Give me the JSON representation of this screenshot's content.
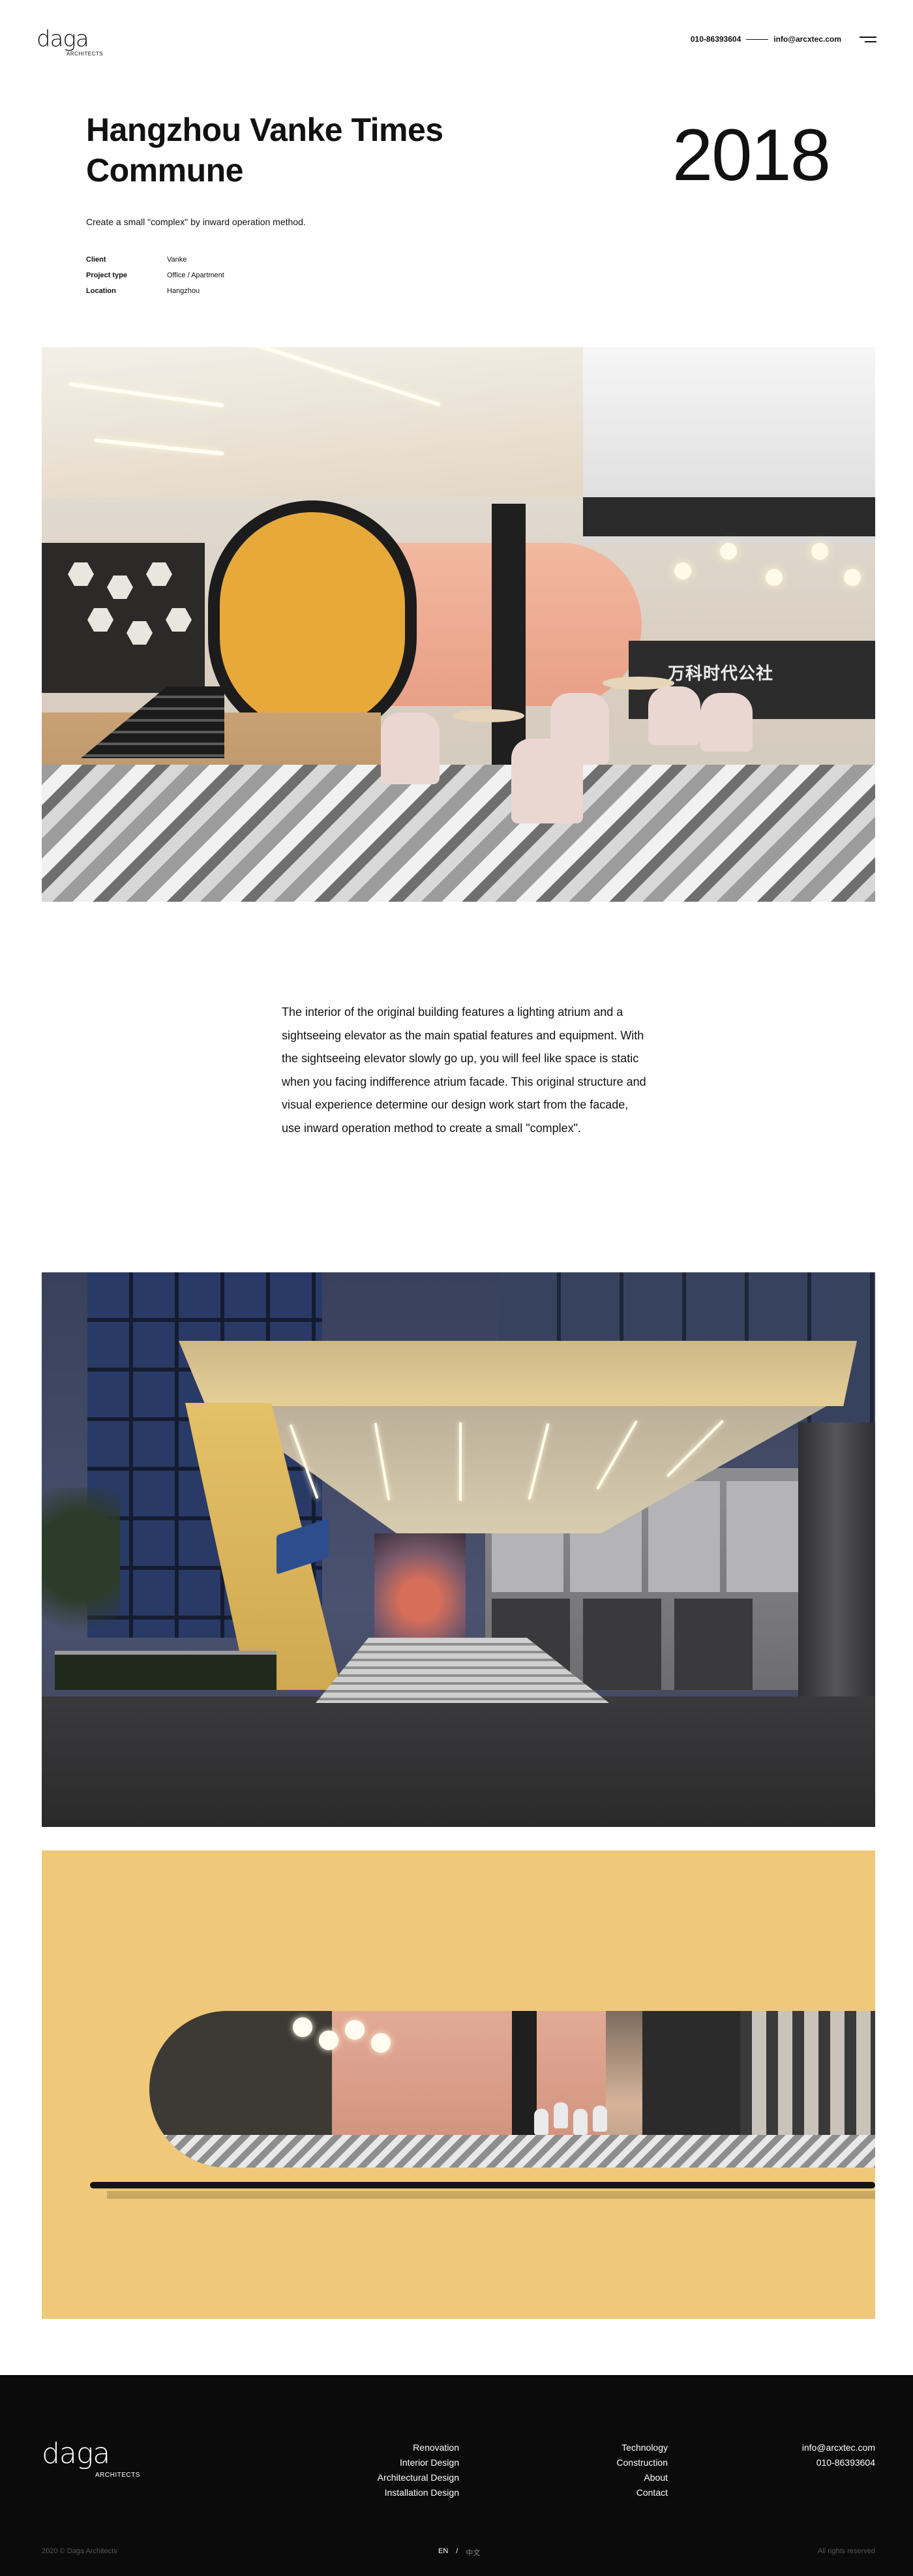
{
  "brand": {
    "logo_text": "daga",
    "logo_sub": "ARCHITECTS"
  },
  "header": {
    "phone": "010-86393604",
    "email": "info@arcxtec.com",
    "menu_icon": "hamburger-icon"
  },
  "project": {
    "title": "Hangzhou Vanke Times Commune",
    "year": "2018",
    "tagline": "Create a small \"complex\" by inward operation method.",
    "meta": [
      {
        "key": "Client",
        "value": "Vanke"
      },
      {
        "key": "Project type",
        "value": "Office / Apartment"
      },
      {
        "key": "Location",
        "value": "Hangzhou"
      }
    ],
    "description": "The interior of the original building features a lighting atrium and a sightseeing elevator as the main spatial features and equipment. With the sightseeing elevator slowly go up, you will feel like space is static when you facing indifference atrium facade. This original structure and visual experience determine our design work start from the facade, use inward operation method to create a small \"complex\"."
  },
  "photos": {
    "interior_sign": "万科时代公社"
  },
  "footer": {
    "logo_text": "daga",
    "logo_sub": "ARCHITECTS",
    "services": [
      "Renovation",
      "Interior Design",
      "Architectural Design",
      "Installation Design"
    ],
    "links": [
      "Technology",
      "Construction",
      "About",
      "Contact"
    ],
    "email": "info@arcxtec.com",
    "phone": "010-86393604",
    "copyright": "2020 © Daga Architects",
    "lang_en": "EN",
    "lang_sep": "/",
    "lang_cn": "中文",
    "rights": "All rights reserved"
  },
  "colors": {
    "accent_yellow": "#efc879",
    "footer_bg": "#0b0b0b",
    "text": "#111111"
  }
}
